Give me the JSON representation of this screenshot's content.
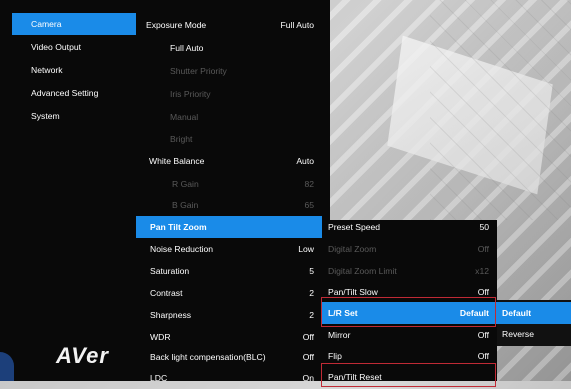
{
  "left_menu": [
    {
      "label": "Camera",
      "selected": true
    },
    {
      "label": "Video Output"
    },
    {
      "label": "Network"
    },
    {
      "label": "Advanced Setting"
    },
    {
      "label": "System"
    }
  ],
  "camera_menu": {
    "exposure_mode": {
      "label": "Exposure Mode",
      "value": "Full Auto"
    },
    "exposure_options": [
      {
        "label": "Full Auto",
        "enabled": true
      },
      {
        "label": "Shutter Priority",
        "enabled": false
      },
      {
        "label": "Iris Priority",
        "enabled": false
      },
      {
        "label": "Manual",
        "enabled": false
      },
      {
        "label": "Bright",
        "enabled": false
      }
    ],
    "white_balance": {
      "label": "White Balance",
      "value": "Auto"
    },
    "r_gain": {
      "label": "R Gain",
      "value": "82"
    },
    "b_gain": {
      "label": "B Gain",
      "value": "65"
    },
    "items": [
      {
        "label": "Pan Tilt Zoom",
        "value": "",
        "selected": true
      },
      {
        "label": "Noise Reduction",
        "value": "Low"
      },
      {
        "label": "Saturation",
        "value": "5"
      },
      {
        "label": "Contrast",
        "value": "2"
      },
      {
        "label": "Sharpness",
        "value": "2"
      },
      {
        "label": "WDR",
        "value": "Off"
      },
      {
        "label": "Back light compensation(BLC)",
        "value": "Off"
      },
      {
        "label": "LDC",
        "value": "On"
      }
    ]
  },
  "ptz_menu": [
    {
      "label": "Preset Speed",
      "value": "50",
      "enabled": true
    },
    {
      "label": "Digital Zoom",
      "value": "Off",
      "enabled": false
    },
    {
      "label": "Digital Zoom Limit",
      "value": "x12",
      "enabled": false
    },
    {
      "label": "Pan/Tilt Slow",
      "value": "Off",
      "enabled": true
    },
    {
      "label": "L/R Set",
      "value": "Default",
      "enabled": true,
      "selected": true
    },
    {
      "label": "Mirror",
      "value": "Off",
      "enabled": true
    },
    {
      "label": "Flip",
      "value": "Off",
      "enabled": true
    },
    {
      "label": "Pan/Tilt Reset",
      "value": "",
      "enabled": true
    }
  ],
  "lr_options": [
    {
      "label": "Default",
      "selected": true
    },
    {
      "label": "Reverse"
    }
  ],
  "brand": {
    "logo_text": "AVer"
  },
  "colors": {
    "highlight": "#1a8be8",
    "menu_bg": "#090909",
    "red_box": "#c02a35"
  }
}
